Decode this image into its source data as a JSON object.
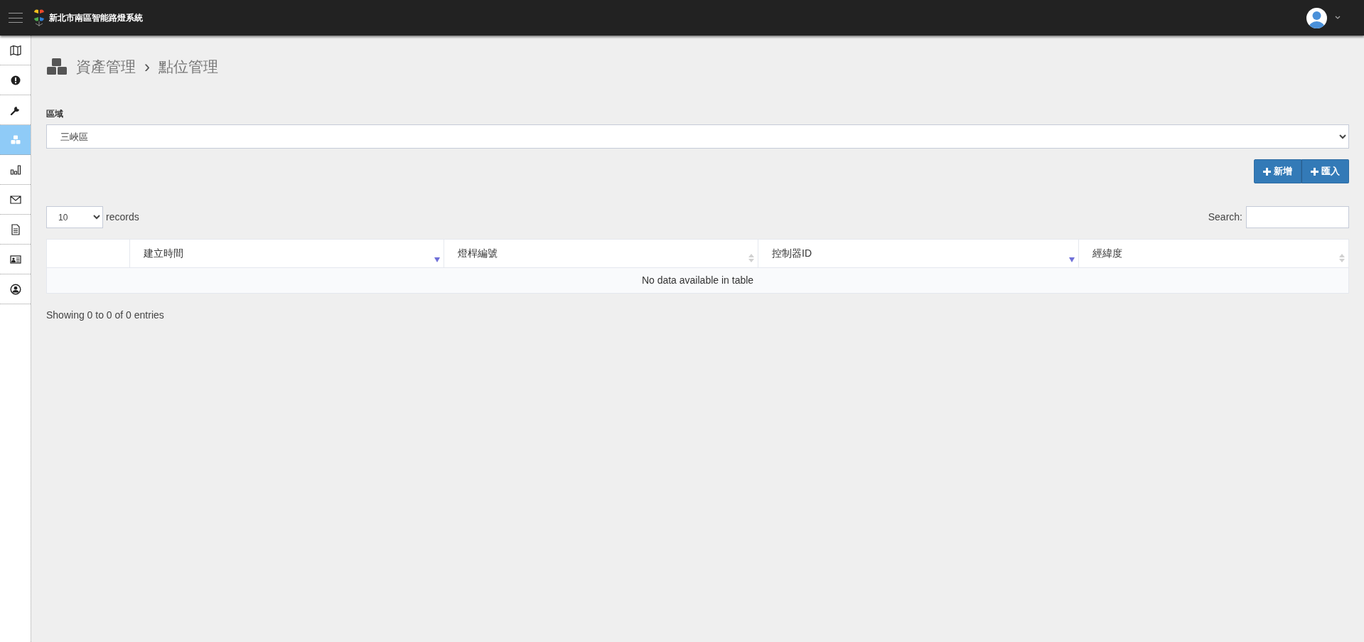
{
  "header": {
    "title": "新北市南區智能路燈系統"
  },
  "sidebar": {
    "items": [
      {
        "selected": false
      },
      {
        "selected": false
      },
      {
        "selected": false
      },
      {
        "selected": true
      },
      {
        "selected": false
      },
      {
        "selected": false
      },
      {
        "selected": false
      },
      {
        "selected": false
      },
      {
        "selected": false
      }
    ]
  },
  "breadcrumb": [
    "資產管理",
    "點位管理"
  ],
  "breadcrumb_separator": "›",
  "region": {
    "label": "區域",
    "value": "三峽區"
  },
  "buttons": [
    "新增",
    "匯入"
  ],
  "length": {
    "value": "10",
    "label": "records"
  },
  "search": {
    "label": "Search:"
  },
  "table": {
    "columns": [
      {
        "sortable": false,
        "sorted": false
      },
      {
        "label": "建立時間",
        "sortable": true,
        "sorted": true
      },
      {
        "label": "燈桿編號",
        "sortable": true,
        "sorted": false
      },
      {
        "label": "控制器ID",
        "sortable": true,
        "sorted": true
      },
      {
        "label": "經緯度",
        "sortable": true,
        "sorted": false
      }
    ],
    "empty": "No data available in table"
  },
  "info": "Showing 0 to 0 of 0 entries"
}
